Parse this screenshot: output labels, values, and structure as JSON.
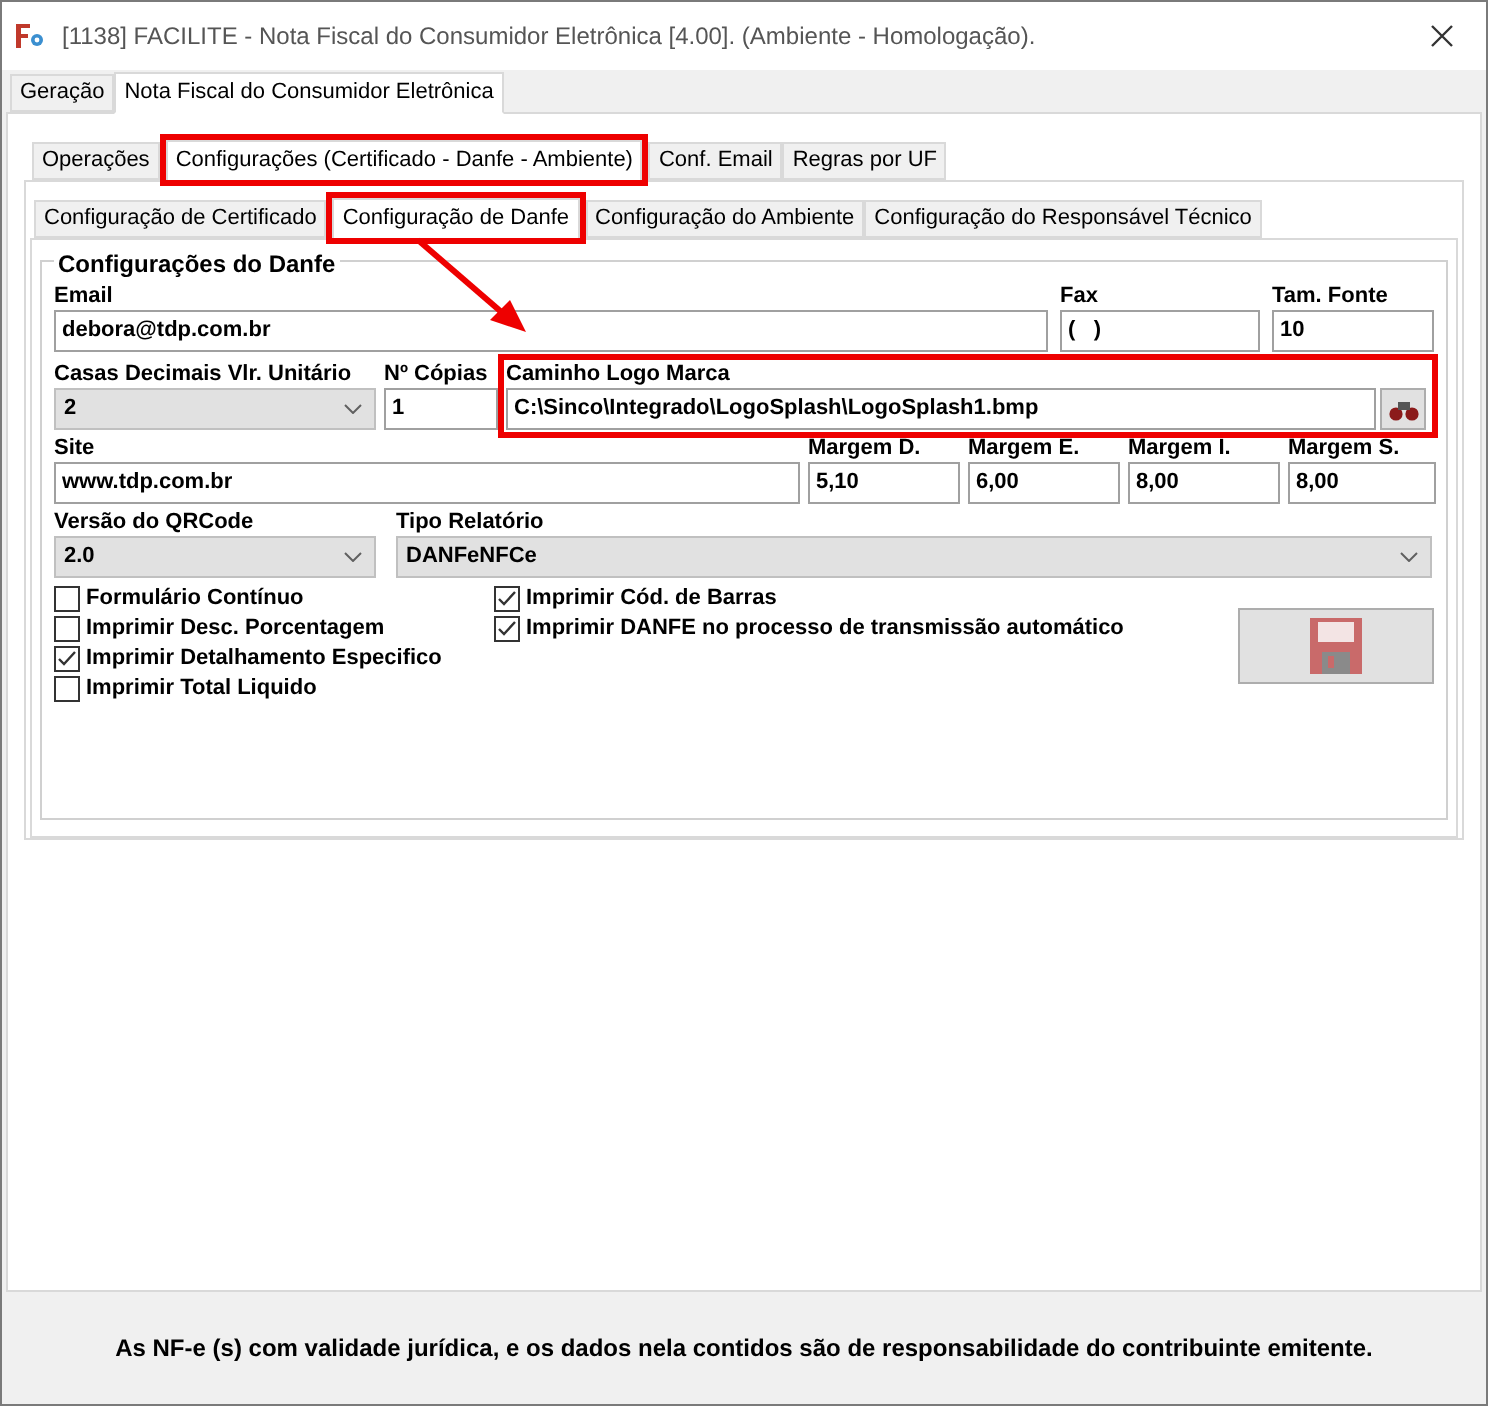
{
  "window": {
    "title": "[1138] FACILITE - Nota Fiscal do Consumidor Eletrônica [4.00]. (Ambiente - Homologação)."
  },
  "outer_tabs": [
    {
      "label": "Geração",
      "selected": false
    },
    {
      "label": "Nota Fiscal do Consumidor Eletrônica",
      "selected": true
    }
  ],
  "tabs": [
    {
      "label": "Operações",
      "selected": false
    },
    {
      "label": "Configurações (Certificado - Danfe - Ambiente)",
      "selected": true
    },
    {
      "label": "Conf. Email",
      "selected": false
    },
    {
      "label": "Regras por UF",
      "selected": false
    }
  ],
  "subtabs": [
    {
      "label": "Configuração de Certificado",
      "selected": false
    },
    {
      "label": "Configuração de Danfe",
      "selected": true
    },
    {
      "label": "Configuração do Ambiente",
      "selected": false
    },
    {
      "label": "Configuração do Responsável Técnico",
      "selected": false
    }
  ],
  "group": {
    "title": "Configurações do Danfe"
  },
  "email": {
    "label": "Email",
    "value": "debora@tdp.com.br"
  },
  "fax": {
    "label": "Fax",
    "value": "(   )"
  },
  "font_size": {
    "label": "Tam. Fonte",
    "value": "10"
  },
  "decimals": {
    "label": "Casas Decimais Vlr. Unitário",
    "value": "2"
  },
  "copies": {
    "label": "Nº Cópias",
    "value": "1"
  },
  "logo_path": {
    "label": "Caminho Logo Marca",
    "value": "C:\\Sinco\\Integrado\\LogoSplash\\LogoSplash1.bmp"
  },
  "site": {
    "label": "Site",
    "value": "www.tdp.com.br"
  },
  "margins": [
    {
      "label": "Margem D.",
      "value": "5,10"
    },
    {
      "label": "Margem E.",
      "value": "6,00"
    },
    {
      "label": "Margem I.",
      "value": "8,00"
    },
    {
      "label": "Margem S.",
      "value": "8,00"
    }
  ],
  "qrcode_version": {
    "label": "Versão do QRCode",
    "value": "2.0"
  },
  "report_type": {
    "label": "Tipo Relatório",
    "value": "DANFeNFCe"
  },
  "checkboxes_left": [
    {
      "label": "Formulário Contínuo",
      "checked": false
    },
    {
      "label": "Imprimir Desc. Porcentagem",
      "checked": false
    },
    {
      "label": "Imprimir Detalhamento Especifico",
      "checked": true
    },
    {
      "label": "Imprimir Total Liquido",
      "checked": false
    }
  ],
  "checkboxes_right": [
    {
      "label": "Imprimir Cód. de Barras",
      "checked": true
    },
    {
      "label": "Imprimir DANFE no processo de transmissão automático",
      "checked": true
    }
  ],
  "footer": {
    "text": "As NF-e (s) com validade jurídica, e os dados nela contidos são de responsabilidade do contribuinte emitente."
  }
}
